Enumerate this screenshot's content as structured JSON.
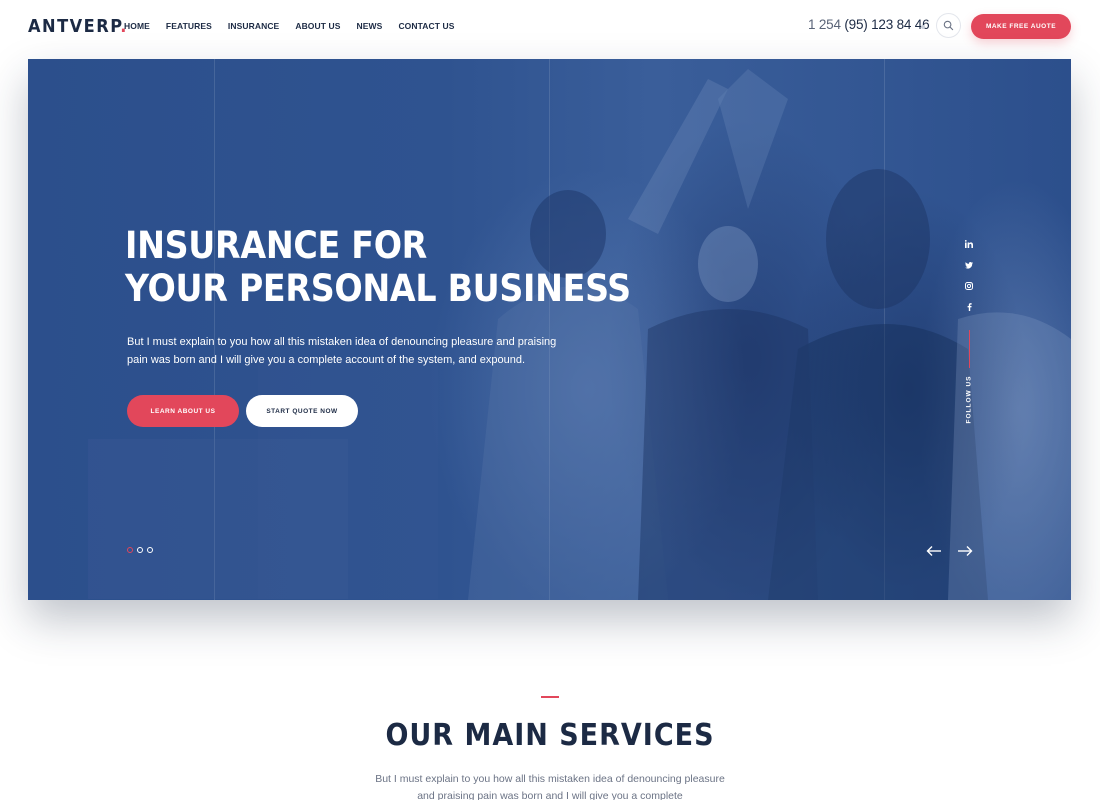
{
  "header": {
    "logo": "ANTVERP",
    "logo_dot": ".",
    "nav": [
      "HOME",
      "FEATURES",
      "INSURANCE",
      "ABOUT US",
      "NEWS",
      "CONTACT US"
    ],
    "phone_prefix": "1 254",
    "phone_number": "(95) 123 84 46",
    "search_icon": "search-icon",
    "quote_button": "MAKE FREE AUOTE"
  },
  "hero": {
    "title_line1": "INSURANCE FOR",
    "title_line2": "YOUR PERSONAL BUSINESS",
    "description": "But I must explain to you how all this mistaken idea of denouncing pleasure and praising pain was born and I will give you a complete account of the system, and expound.",
    "learn_button": "LEARN ABOUT US",
    "start_button": "START QUOTE NOW",
    "slide_count": 3,
    "active_slide": 1,
    "social_icons": [
      "linkedin-icon",
      "twitter-icon",
      "instagram-icon",
      "facebook-icon"
    ],
    "follow_label": "FOLLOW US",
    "prev_icon": "arrow-left-icon",
    "next_icon": "arrow-right-icon"
  },
  "services": {
    "title": "OUR MAIN SERVICES",
    "description": "But I must explain to you how all this mistaken idea of denouncing pleasure and praising pain was born and I will give you a complete"
  },
  "colors": {
    "accent": "#e2475b",
    "navy": "#1c2a44",
    "hero_overlay": "#2f5390"
  }
}
